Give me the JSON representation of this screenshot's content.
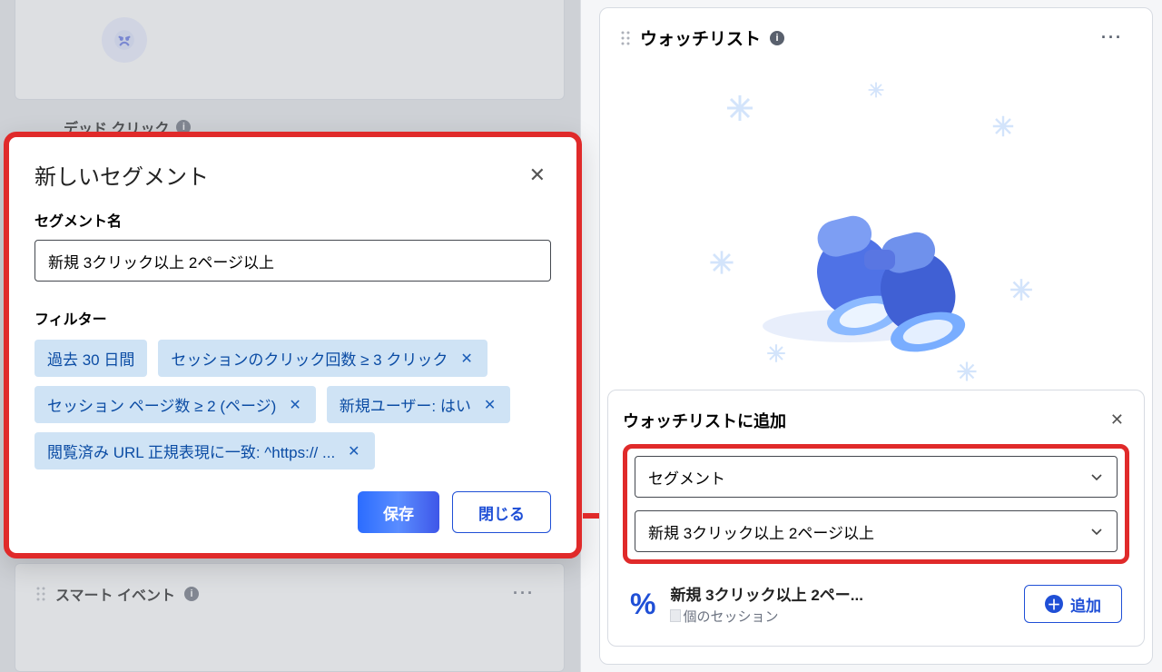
{
  "left_bg": {
    "dead_click_label": "デッド クリック",
    "smart_event_label": "スマート イベント"
  },
  "modal": {
    "title": "新しいセグメント",
    "name_label": "セグメント名",
    "name_value": "新規 3クリック以上 2ページ以上",
    "filters_label": "フィルター",
    "filters": [
      {
        "text": "過去 30 日間",
        "removable": false
      },
      {
        "text": "セッションのクリック回数 ≥ 3 クリック",
        "removable": true
      },
      {
        "text": "セッション ページ数 ≥ 2 (ページ)",
        "removable": true
      },
      {
        "text": "新規ユーザー: はい",
        "removable": true
      },
      {
        "text": "閲覧済み URL 正規表現に一致: ^https://                            ...",
        "removable": true
      }
    ],
    "save_label": "保存",
    "close_label": "閉じる"
  },
  "right": {
    "header": "ウォッチリスト",
    "add": {
      "title": "ウォッチリストに追加",
      "select1": "セグメント",
      "select2": "新規 3クリック以上 2ページ以上",
      "result_title": "新規 3クリック以上 2ペー...",
      "result_sub": "個のセッション",
      "percent_symbol": "%",
      "add_button": "追加"
    }
  }
}
